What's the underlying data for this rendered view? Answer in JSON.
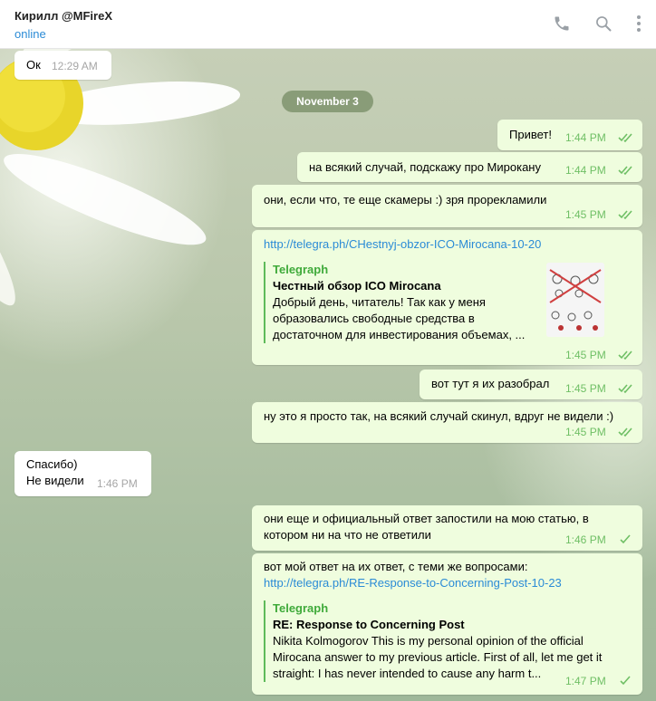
{
  "header": {
    "contact_name": "Кирилл @MFireX",
    "status": "online",
    "icons": [
      "phone-icon",
      "search-icon",
      "more-vertical-icon"
    ]
  },
  "colors": {
    "accent": "#2b8bd6",
    "outgoing_bubble": "#effdde",
    "incoming_bubble": "#ffffff",
    "read_ticks": "#6fbf65",
    "date_pill": "#788e66"
  },
  "date_separator": "November 3",
  "messages": [
    {
      "id": "m1",
      "direction": "in",
      "text": "Ок",
      "time": "12:29 AM"
    },
    {
      "id": "m2",
      "direction": "out",
      "text": "Привет!",
      "time": "1:44 PM",
      "ticks": "double"
    },
    {
      "id": "m3",
      "direction": "out",
      "text": "на всякий случай, подскажу про Мирокану",
      "time": "1:44 PM",
      "ticks": "double"
    },
    {
      "id": "m4",
      "direction": "out",
      "text": "они, если что, те еще скамеры :) зря прорекламили",
      "time": "1:45 PM",
      "ticks": "double"
    },
    {
      "id": "m5",
      "direction": "out",
      "link": "http://telegra.ph/CHestnyj-obzor-ICO-Mirocana-10-20",
      "preview": {
        "site": "Telegraph",
        "title": "Честный обзор ICO Mirocana",
        "desc": [
          "Добрый день, читатель! Так как у меня",
          "образовались свободные средства в",
          "достаточном для инвестирования объемах, ..."
        ]
      },
      "time": "1:45 PM",
      "ticks": "double"
    },
    {
      "id": "m6",
      "direction": "out",
      "text": "вот тут я их разобрал",
      "time": "1:45 PM",
      "ticks": "double"
    },
    {
      "id": "m7",
      "direction": "out",
      "text": "ну это я просто так, на всякий случай скинул, вдруг не видели :)",
      "time": "1:45 PM",
      "ticks": "double"
    },
    {
      "id": "m8",
      "direction": "in",
      "lines": [
        "Спасибо)",
        "Не видели"
      ],
      "time": "1:46 PM"
    },
    {
      "id": "m9",
      "direction": "out",
      "lines": [
        "они еще и официальный ответ запостили на мою статью, в",
        "котором ни на что не ответили"
      ],
      "time": "1:46 PM",
      "ticks": "single"
    },
    {
      "id": "m10",
      "direction": "out",
      "text": "вот мой ответ на их ответ, с теми же вопросами:",
      "link": "http://telegra.ph/RE-Response-to-Concerning-Post-10-23",
      "preview": {
        "site": "Telegraph",
        "title": "RE: Response to Concerning Post",
        "desc": [
          "Nikita Kolmogorov This is my personal opinion of the official",
          "Mirocana answer to my previous article. First of all, let me get it",
          "straight: I has never intended to cause any harm t..."
        ]
      },
      "time": "1:47 PM",
      "ticks": "single"
    }
  ]
}
